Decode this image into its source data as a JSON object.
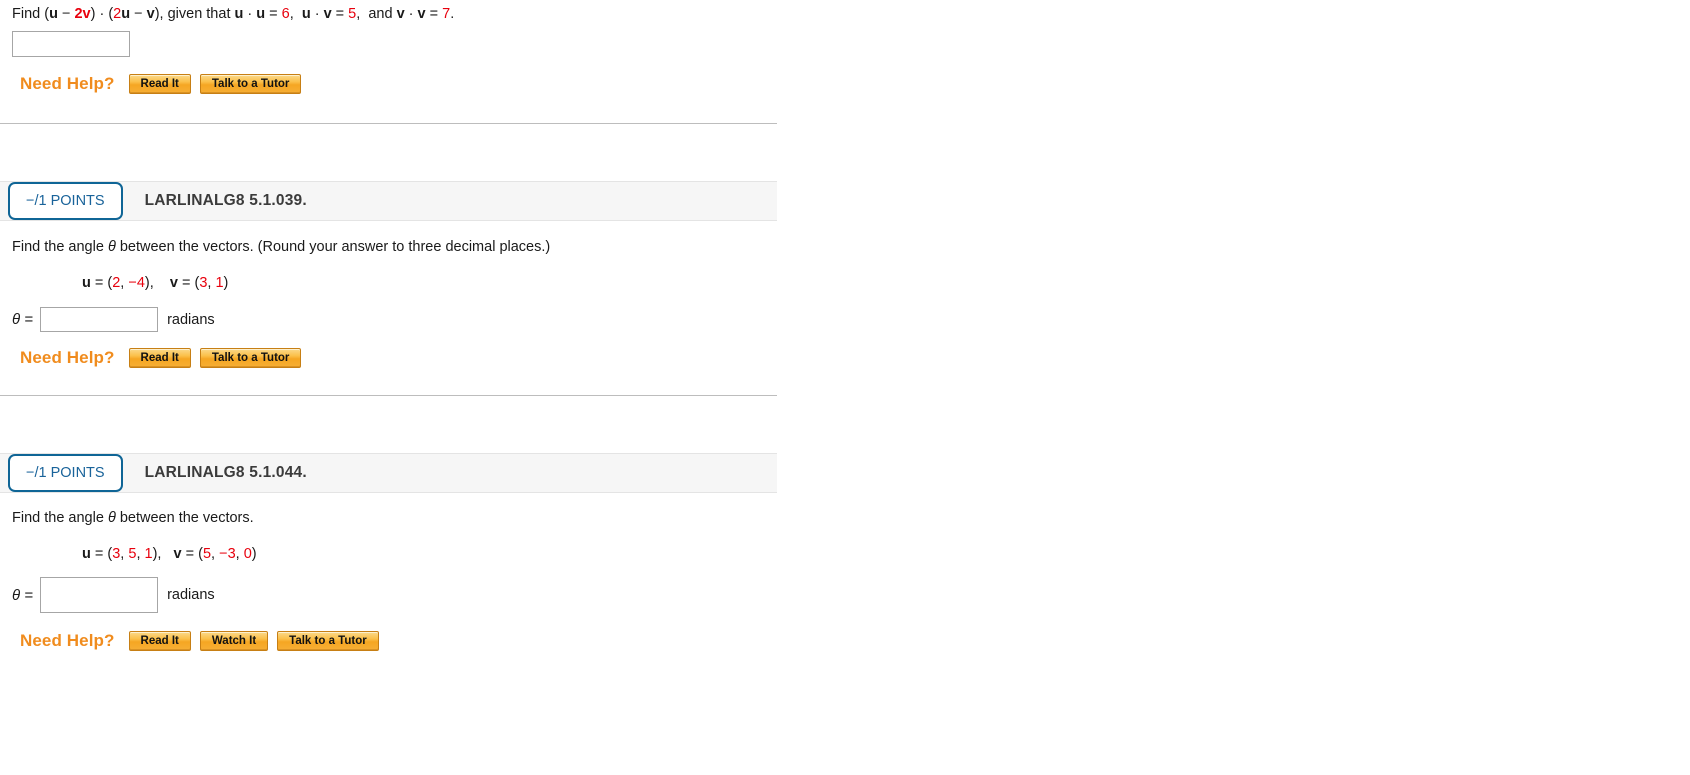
{
  "colors": {
    "accent_red": "#e8000d",
    "badge_blue": "#0f6596",
    "help_orange": "#f08c1e",
    "header_bg": "#f6f6f6"
  },
  "questions": [
    {
      "id": "q-partial-top",
      "prompt": {
        "segments": [
          {
            "text": "Find (",
            "style": "plain"
          },
          {
            "text": "u",
            "style": "bold"
          },
          {
            "text": " − ",
            "style": "plain"
          },
          {
            "text": "2",
            "style": "red"
          },
          {
            "text": "v",
            "style": "bold-red"
          },
          {
            "text": ") · (",
            "style": "plain"
          },
          {
            "text": "2",
            "style": "red"
          },
          {
            "text": "u",
            "style": "bold"
          },
          {
            "text": " − ",
            "style": "plain"
          },
          {
            "text": "v",
            "style": "bold"
          },
          {
            "text": "), given that ",
            "style": "plain"
          },
          {
            "text": "u",
            "style": "bold"
          },
          {
            "text": " · ",
            "style": "plain"
          },
          {
            "text": "u",
            "style": "bold"
          },
          {
            "text": " = ",
            "style": "plain"
          },
          {
            "text": "6",
            "style": "red"
          },
          {
            "text": ",  ",
            "style": "plain"
          },
          {
            "text": "u",
            "style": "bold"
          },
          {
            "text": " · ",
            "style": "plain"
          },
          {
            "text": "v",
            "style": "bold"
          },
          {
            "text": " = ",
            "style": "plain"
          },
          {
            "text": "5",
            "style": "red"
          },
          {
            "text": ",  and ",
            "style": "plain"
          },
          {
            "text": "v",
            "style": "bold"
          },
          {
            "text": " · ",
            "style": "plain"
          },
          {
            "text": "v",
            "style": "bold"
          },
          {
            "text": " = ",
            "style": "plain"
          },
          {
            "text": "7",
            "style": "red"
          },
          {
            "text": ".",
            "style": "plain"
          }
        ]
      },
      "answer": {
        "value": "",
        "placeholder": ""
      },
      "need_help": {
        "label": "Need Help?",
        "buttons": [
          "Read It",
          "Talk to a Tutor"
        ]
      }
    },
    {
      "id": "q-5-1-039",
      "header": {
        "points": "−/1 POINTS",
        "title": "LARLINALG8 5.1.039."
      },
      "prompt_text": "Find the angle θ between the vectors. (Round your answer to three decimal places.)",
      "prompt_parts": {
        "before_theta": "Find the angle ",
        "theta": "θ",
        "after_theta": " between the vectors. (Round your answer to three decimal places.)"
      },
      "vectors": [
        {
          "name": "u",
          "components": [
            "2",
            "−4"
          ]
        },
        {
          "name": "v",
          "components": [
            "3",
            "1"
          ]
        }
      ],
      "answer": {
        "label": "θ =",
        "value": "",
        "placeholder": "",
        "units": "radians"
      },
      "need_help": {
        "label": "Need Help?",
        "buttons": [
          "Read It",
          "Talk to a Tutor"
        ]
      }
    },
    {
      "id": "q-5-1-044",
      "header": {
        "points": "−/1 POINTS",
        "title": "LARLINALG8 5.1.044."
      },
      "prompt_parts": {
        "before_theta": "Find the angle ",
        "theta": "θ",
        "after_theta": " between the vectors."
      },
      "vectors": [
        {
          "name": "u",
          "components": [
            "3",
            "5",
            "1"
          ]
        },
        {
          "name": "v",
          "components": [
            "5",
            "−3",
            "0"
          ]
        }
      ],
      "answer": {
        "label": "θ =",
        "value": "",
        "placeholder": "",
        "units": "radians"
      },
      "need_help": {
        "label": "Need Help?",
        "buttons": [
          "Read It",
          "Watch It",
          "Talk to a Tutor"
        ]
      }
    }
  ]
}
